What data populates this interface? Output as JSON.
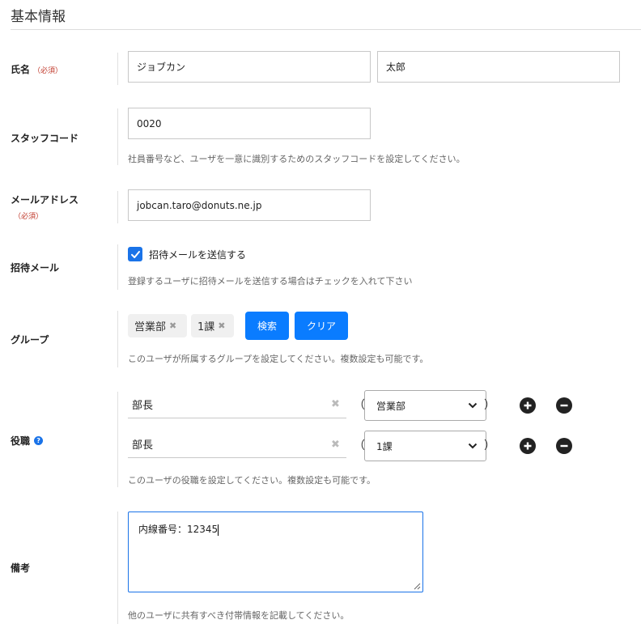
{
  "section": {
    "title": "基本情報"
  },
  "name": {
    "label": "氏名",
    "required": "（必須）",
    "last_value": "ジョブカン",
    "first_value": "太郎"
  },
  "staff_code": {
    "label": "スタッフコード",
    "value": "0020",
    "help": "社員番号など、ユーザを一意に識別するためのスタッフコードを設定してください。"
  },
  "email": {
    "label": "メールアドレス",
    "required": "（必須）",
    "value": "jobcan.taro@donuts.ne.jp"
  },
  "invite": {
    "label": "招待メール",
    "checkbox_label": "招待メールを送信する",
    "checked": true,
    "help": "登録するユーザに招待メールを送信する場合はチェックを入れて下さい"
  },
  "group": {
    "label": "グループ",
    "chips": [
      "営業部",
      "1課"
    ],
    "search_button": "検索",
    "clear_button": "クリア",
    "help": "このユーザが所属するグループを設定してください。複数設定も可能です。"
  },
  "position": {
    "label": "役職",
    "rows": [
      {
        "title": "部長",
        "paren_open": "（",
        "group": "営業部",
        "paren_close": "）"
      },
      {
        "title": "部長",
        "paren_open": "（",
        "group": "1課",
        "paren_close": "）"
      }
    ],
    "help": "このユーザの役職を設定してください。複数設定も可能です。"
  },
  "notes": {
    "label": "備考",
    "value": "内線番号：12345",
    "help": "他のユーザに共有すべき付帯情報を記載してください。"
  },
  "colors": {
    "accent": "#0a7cff",
    "required": "#c0392b",
    "help": "#1a73e8"
  }
}
